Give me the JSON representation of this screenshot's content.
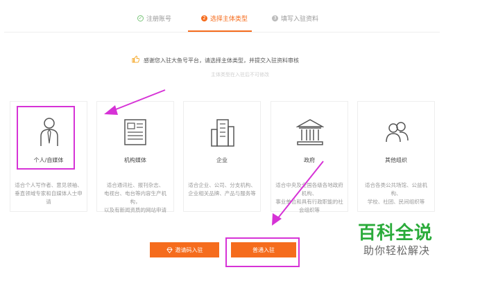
{
  "steps": [
    {
      "label": "注册账号",
      "icon": "check-circle-icon",
      "state": "done"
    },
    {
      "label": "选择主体类型",
      "icon": "number-2-icon",
      "number": "2",
      "state": "active"
    },
    {
      "label": "填写入驻资料",
      "icon": "number-3-icon",
      "number": "3",
      "state": "pending"
    }
  ],
  "notice": {
    "text": "感谢您入驻大鱼号平台，请选择主体类型，并提交入驻资料审核",
    "icon": "thumbs-up-icon",
    "subtext": "主体类型在入驻后不可修改"
  },
  "cards": [
    {
      "label": "个人/自媒体",
      "icon": "person-icon",
      "desc_lines": [
        "适合个人写作者、意见领袖、",
        "垂直领域专家和自媒体人士申",
        "请"
      ]
    },
    {
      "label": "机构媒体",
      "icon": "newspaper-icon",
      "desc_lines": [
        "适合通讯社、报刊杂志、",
        "电视台、电台等内容生产机",
        "构，",
        "以及有新闻资质的网站申请"
      ]
    },
    {
      "label": "企业",
      "icon": "building-icon",
      "desc_lines": [
        "适合企业、公司、分支机构、",
        "企业相关品牌、产品与服务等"
      ]
    },
    {
      "label": "政府",
      "icon": "government-icon",
      "desc_lines": [
        "适合中央及全国各级各地政府",
        "机构、",
        "事业单位和具有行政职能的社",
        "会组织等"
      ]
    },
    {
      "label": "其他组织",
      "icon": "group-icon",
      "desc_lines": [
        "适合各类公共场馆、公益机",
        "构、",
        "学校、社团、民间组织等"
      ]
    }
  ],
  "buttons": {
    "invite_label": "邀请码入驻",
    "invite_icon": "diamond-icon",
    "normal_label": "普通入驻"
  },
  "watermark": {
    "title": "百科全说",
    "subtitle": "助你轻松解决"
  },
  "colors": {
    "accent": "#f56c1d",
    "annotation": "#d632d6",
    "done": "#7bc67b",
    "watermark": "#2aab3a"
  }
}
